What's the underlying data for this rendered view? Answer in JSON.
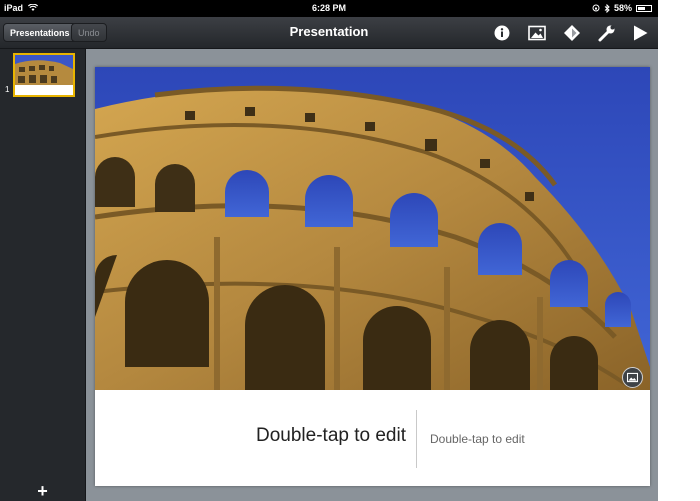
{
  "status_bar": {
    "carrier": "iPad",
    "time": "6:28 PM",
    "battery_percent": "58%",
    "battery_level": 0.58,
    "icons": [
      "wifi-icon",
      "lock-rotation-icon",
      "bluetooth-icon",
      "battery-icon"
    ]
  },
  "toolbar": {
    "presentations_label": "Presentations",
    "undo_label": "Undo",
    "title": "Presentation",
    "icons": [
      "info-icon",
      "media-icon",
      "shapes-icon",
      "tools-icon",
      "play-icon"
    ]
  },
  "sidebar": {
    "slides": [
      {
        "number": "1"
      }
    ],
    "add_label": "+"
  },
  "slide": {
    "title_placeholder": "Double-tap to edit",
    "subtitle_placeholder": "Double-tap to edit",
    "image_description_icon": "colosseum-photo",
    "media_button_icon": "photo-icon"
  },
  "colors": {
    "sky": "#3a56c8",
    "stone": "#b58a3e",
    "selection": "#e8b400",
    "toolbar": "#2f3236"
  }
}
